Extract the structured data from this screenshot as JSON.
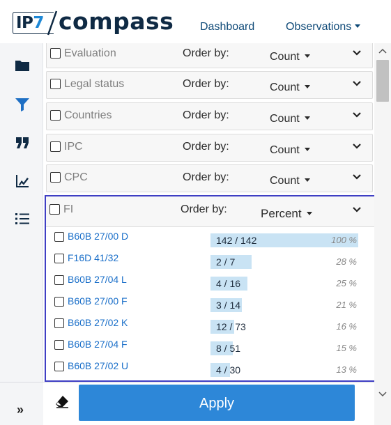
{
  "header": {
    "logo": {
      "prefix_dark": "IP",
      "prefix_accent": "7",
      "wordmark": "compass"
    },
    "nav": [
      {
        "label": "Dashboard"
      },
      {
        "label": "Observations"
      }
    ]
  },
  "sidebar": {
    "icons": [
      "folder-icon",
      "filter-icon",
      "quote-icon",
      "chart-edit-icon",
      "list-icon"
    ],
    "expand_icon": "double-chevron-right-icon"
  },
  "filters": [
    {
      "name": "Evaluation",
      "order_label": "Order by:",
      "sort": "Count"
    },
    {
      "name": "Legal status",
      "order_label": "Order by:",
      "sort": "Count"
    },
    {
      "name": "Countries",
      "order_label": "Order by:",
      "sort": "Count"
    },
    {
      "name": "IPC",
      "order_label": "Order by:",
      "sort": "Count"
    },
    {
      "name": "CPC",
      "order_label": "Order by:",
      "sort": "Count"
    }
  ],
  "fi_filter": {
    "name": "FI",
    "order_label": "Order by:",
    "sort": "Percent",
    "rows": [
      {
        "code": "B60B 27/00 D",
        "count": "142 / 142",
        "percent": "100 %",
        "fraction": 1.0
      },
      {
        "code": "F16D 41/32",
        "count": "2 / 7",
        "percent": "28 %",
        "fraction": 0.28
      },
      {
        "code": "B60B 27/04 L",
        "count": "4 / 16",
        "percent": "25 %",
        "fraction": 0.25
      },
      {
        "code": "B60B 27/00 F",
        "count": "3 / 14",
        "percent": "21 %",
        "fraction": 0.21
      },
      {
        "code": "B60B 27/02 K",
        "count": "12 / 73",
        "percent": "16 %",
        "fraction": 0.16
      },
      {
        "code": "B60B 27/04 F",
        "count": "8 / 51",
        "percent": "15 %",
        "fraction": 0.15
      },
      {
        "code": "B60B 27/02 U",
        "count": "4 / 30",
        "percent": "13 %",
        "fraction": 0.13
      }
    ]
  },
  "footer": {
    "apply_label": "Apply",
    "clear_icon": "eraser-icon"
  },
  "colors": {
    "brand_dark": "#0f2a44",
    "accent": "#1e88d6",
    "apply_button": "#2d87d8",
    "bar_fill": "#c9e3f4",
    "highlight_border": "#3f3fc4"
  }
}
